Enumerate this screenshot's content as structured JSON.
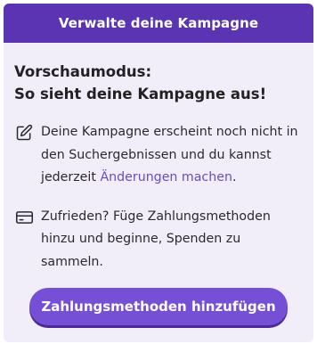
{
  "header": {
    "title": "Verwalte deine Kampagne"
  },
  "preview": {
    "title_line1": "Vorschaumodus:",
    "title_line2": "So sieht deine Kampagne aus!"
  },
  "info_edit": {
    "icon": "pencil-square-icon",
    "text_before_link": "Deine Kampagne erscheint noch nicht in den Suchergebnissen und du kannst jederzeit ",
    "link_text": "Änderungen machen",
    "text_after_link": "."
  },
  "info_payment": {
    "icon": "credit-card-icon",
    "text": "Zufrieden? Füge Zahlungsmethoden hinzu und beginne, Spenden zu sammeln."
  },
  "cta": {
    "label": "Zahlungsmethoden hinzufügen"
  },
  "colors": {
    "header_bg": "#5a34b3",
    "card_bg": "#f1eefa",
    "link": "#6a4bc4",
    "button_bg": "#7550d6"
  }
}
